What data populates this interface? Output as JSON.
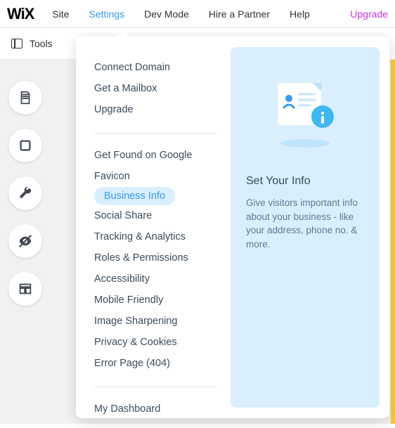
{
  "logo": "WiX",
  "nav": {
    "site": "Site",
    "settings": "Settings",
    "devmode": "Dev Mode",
    "hire": "Hire a Partner",
    "help": "Help",
    "upgrade": "Upgrade"
  },
  "toolsbar": {
    "tools": "Tools"
  },
  "rail": {
    "pages": "pages-icon",
    "bg": "background-icon",
    "tools": "wrench-icon",
    "hide": "eye-off-icon",
    "layout": "layout-icon"
  },
  "menu": {
    "group1": {
      "connect_domain": "Connect Domain",
      "get_mailbox": "Get a Mailbox",
      "upgrade": "Upgrade"
    },
    "group2": {
      "get_found": "Get Found on Google",
      "favicon": "Favicon",
      "business_info": "Business Info",
      "social_share": "Social Share",
      "tracking": "Tracking & Analytics",
      "roles": "Roles & Permissions",
      "accessibility": "Accessibility",
      "mobile": "Mobile Friendly",
      "sharpening": "Image Sharpening",
      "privacy": "Privacy & Cookies",
      "error_page": "Error Page (404)"
    },
    "group3": {
      "dashboard": "My Dashboard"
    }
  },
  "preview": {
    "title": "Set Your Info",
    "desc": "Give visitors important info about your business - like your address, phone no. & more."
  }
}
